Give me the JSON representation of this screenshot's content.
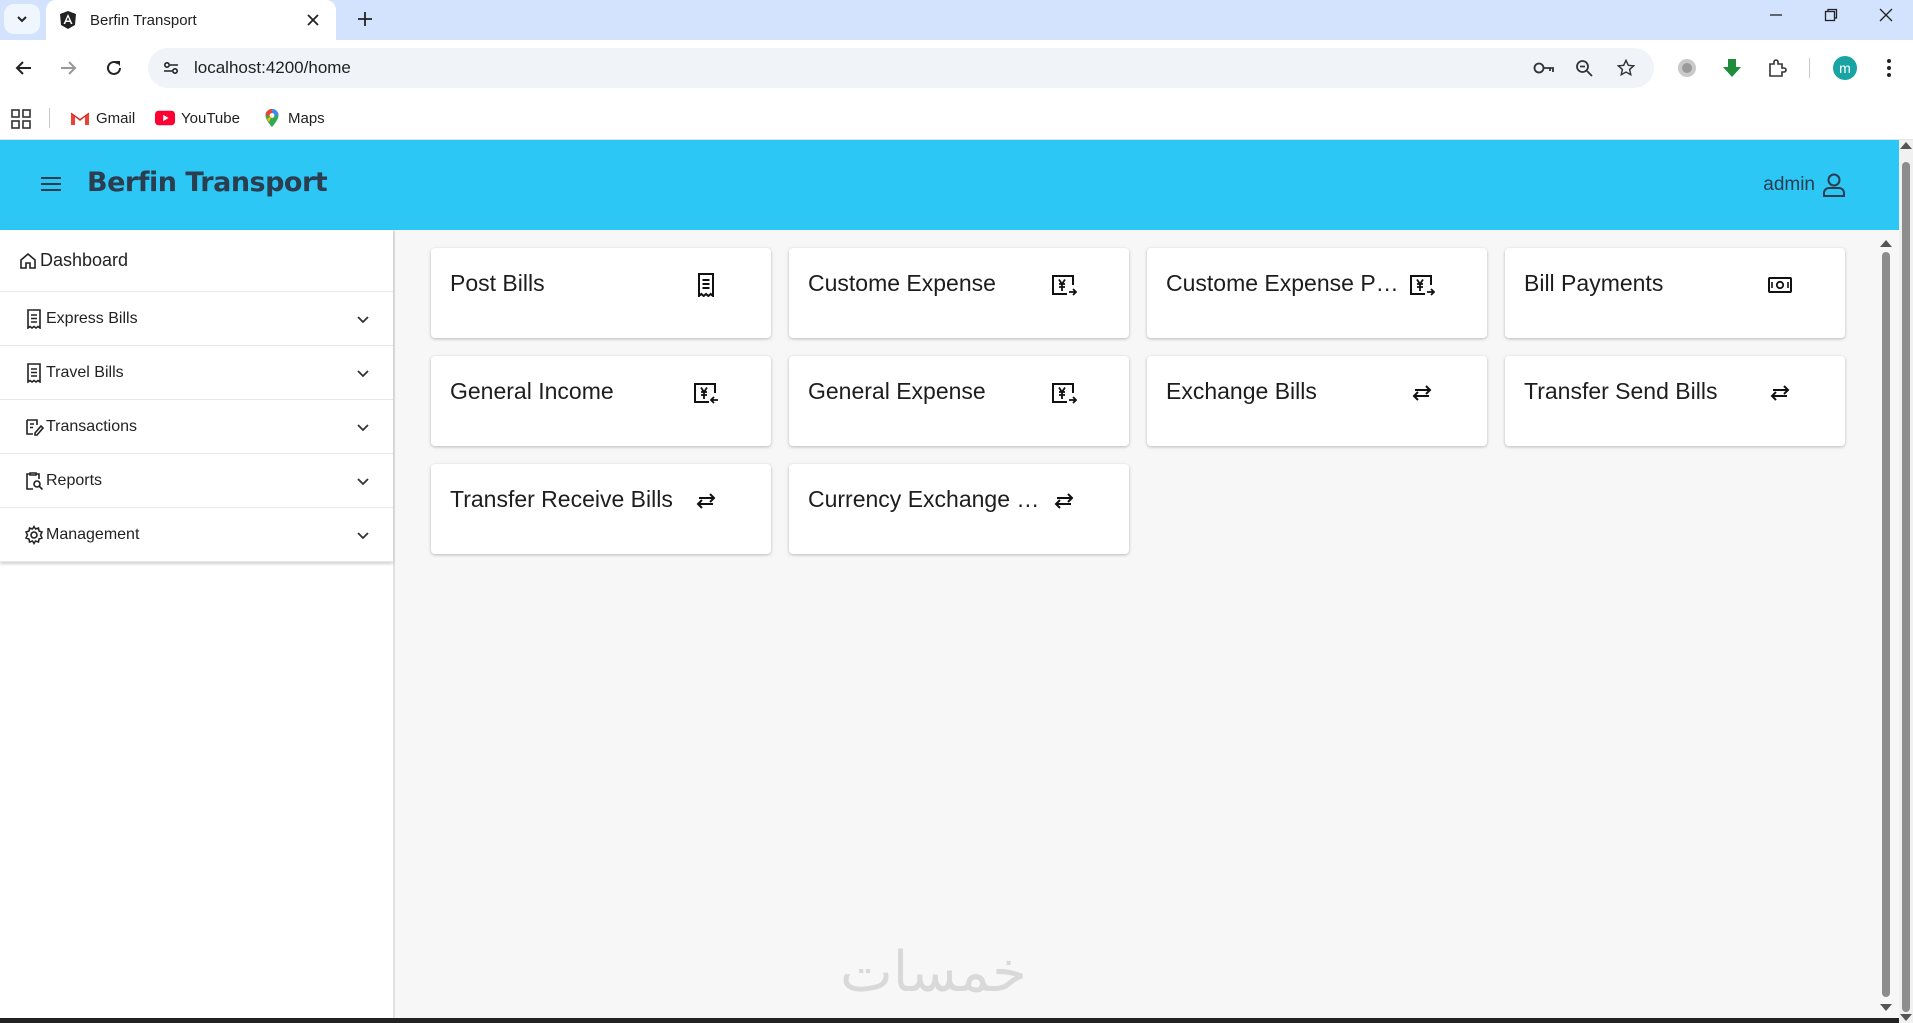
{
  "browser": {
    "tab_title": "Berfin Transport",
    "url": "localhost:4200/home",
    "profile_initial": "m",
    "bookmarks": [
      {
        "label": "Gmail",
        "icon": "gmail-icon"
      },
      {
        "label": "YouTube",
        "icon": "youtube-icon"
      },
      {
        "label": "Maps",
        "icon": "maps-icon"
      }
    ]
  },
  "header": {
    "title": "Berfin Transport",
    "user": "admin",
    "color": "#2cc7f5"
  },
  "sidebar": {
    "dashboard": "Dashboard",
    "items": [
      {
        "label": "Express Bills",
        "icon": "receipt-icon"
      },
      {
        "label": "Travel Bills",
        "icon": "receipt-icon"
      },
      {
        "label": "Transactions",
        "icon": "edit-note-icon"
      },
      {
        "label": "Reports",
        "icon": "report-search-icon"
      },
      {
        "label": "Management",
        "icon": "gear-icon"
      }
    ]
  },
  "cards": [
    {
      "title": "Post Bills",
      "icon": "receipt-icon"
    },
    {
      "title": "Custome Expense",
      "icon": "currency-yen-icon"
    },
    {
      "title": "Custome Expense Payments",
      "icon": "currency-yen-icon"
    },
    {
      "title": "Bill Payments",
      "icon": "payments-icon"
    },
    {
      "title": "General Income",
      "icon": "currency-yen-icon"
    },
    {
      "title": "General Expense",
      "icon": "currency-yen-icon"
    },
    {
      "title": "Exchange Bills",
      "icon": "swap-icon"
    },
    {
      "title": "Transfer Send Bills",
      "icon": "swap-icon"
    },
    {
      "title": "Transfer Receive Bills",
      "icon": "swap-icon"
    },
    {
      "title": "Currency Exchange Bills",
      "icon": "swap-icon"
    }
  ],
  "watermark": "خمسات"
}
